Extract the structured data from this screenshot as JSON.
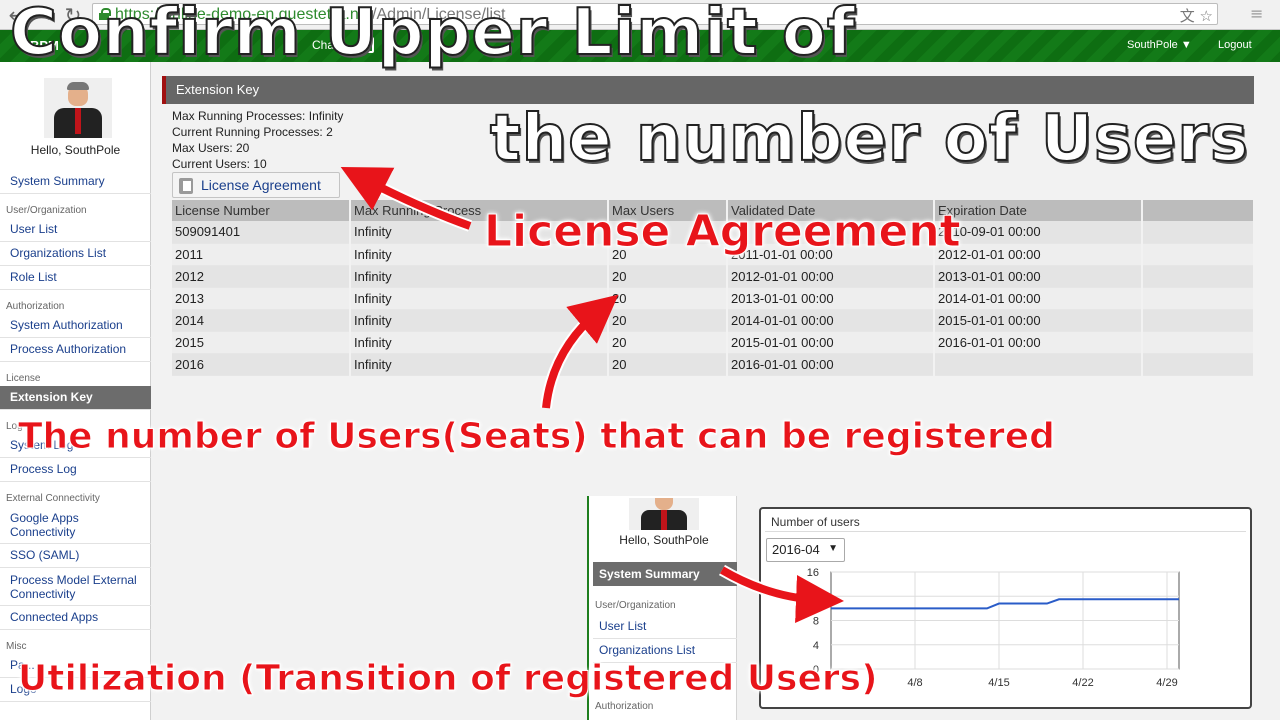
{
  "browser": {
    "back_icon": "back-arrow-icon",
    "forward_icon": "forward-arrow-icon",
    "reload_icon": "reload-icon",
    "url_scheme": "https://",
    "url_host": "online-demo-en.questetra.net",
    "url_path": "/Admin/License/list",
    "icons": [
      "translate-icon",
      "star-icon",
      "menu-icon"
    ]
  },
  "header": {
    "logo": "BPM",
    "chat": "Chat",
    "user_menu": "SouthPole ▼",
    "logout": "Logout"
  },
  "sidebar": {
    "greeting": "Hello, SouthPole",
    "items": [
      {
        "type": "item",
        "label": "System Summary"
      },
      {
        "type": "section",
        "label": "User/Organization"
      },
      {
        "type": "item",
        "label": "User List"
      },
      {
        "type": "item",
        "label": "Organizations List"
      },
      {
        "type": "item",
        "label": "Role List"
      },
      {
        "type": "section",
        "label": "Authorization"
      },
      {
        "type": "item",
        "label": "System Authorization"
      },
      {
        "type": "item",
        "label": "Process Authorization"
      },
      {
        "type": "section",
        "label": "License"
      },
      {
        "type": "item",
        "label": "Extension Key",
        "active": true
      },
      {
        "type": "section",
        "label": "Log"
      },
      {
        "type": "item",
        "label": "System Log"
      },
      {
        "type": "item",
        "label": "Process Log"
      },
      {
        "type": "section",
        "label": "External Connectivity"
      },
      {
        "type": "item",
        "label": "Google Apps Connectivity",
        "tall": true
      },
      {
        "type": "item",
        "label": "SSO (SAML)"
      },
      {
        "type": "item",
        "label": "Process Model External Connectivity",
        "tall": true
      },
      {
        "type": "item",
        "label": "Connected Apps"
      },
      {
        "type": "section",
        "label": "Misc"
      },
      {
        "type": "item",
        "label": "Pa..."
      },
      {
        "type": "item",
        "label": "Logo"
      }
    ]
  },
  "main": {
    "section_title": "Extension Key",
    "info": [
      "Max Running Processes: Infinity",
      "Current Running Processes: 2",
      "Max Users: 20",
      "Current Users: 10"
    ],
    "license_button": "License Agreement",
    "table": {
      "columns": [
        "License Number",
        "Max Running Process",
        "Max Users",
        "Validated Date",
        "Expiration Date",
        ""
      ],
      "rows": [
        [
          "509091401",
          "Infinity",
          "",
          "",
          "2010-09-01 00:00",
          ""
        ],
        [
          "2011",
          "Infinity",
          "20",
          "2011-01-01 00:00",
          "2012-01-01 00:00",
          ""
        ],
        [
          "2012",
          "Infinity",
          "20",
          "2012-01-01 00:00",
          "2013-01-01 00:00",
          ""
        ],
        [
          "2013",
          "Infinity",
          "20",
          "2013-01-01 00:00",
          "2014-01-01 00:00",
          ""
        ],
        [
          "2014",
          "Infinity",
          "20",
          "2014-01-01 00:00",
          "2015-01-01 00:00",
          ""
        ],
        [
          "2015",
          "Infinity",
          "20",
          "2015-01-01 00:00",
          "2016-01-01 00:00",
          ""
        ],
        [
          "2016",
          "Infinity",
          "20",
          "2016-01-01 00:00",
          "",
          ""
        ]
      ]
    }
  },
  "mini_screen": {
    "greeting": "Hello, SouthPole",
    "summary": "System Summary",
    "section_user": "User/Organization",
    "item_users": "User List",
    "item_orgs": "Organizations List",
    "section_auth": "Authorization"
  },
  "chart_panel": {
    "title": "Number of users",
    "month": "2016-04"
  },
  "chart_data": {
    "type": "line",
    "title": "Number of users",
    "xlabel": "",
    "ylabel": "",
    "x_ticks": [
      "4/8",
      "4/15",
      "4/22",
      "4/29"
    ],
    "y_ticks": [
      0,
      4,
      8,
      12,
      16
    ],
    "ylim": [
      0,
      16
    ],
    "grid": true,
    "series": [
      {
        "color": "#2a5cc8",
        "x": [
          "4/1",
          "4/2",
          "4/3",
          "4/4",
          "4/5",
          "4/6",
          "4/7",
          "4/8",
          "4/9",
          "4/10",
          "4/11",
          "4/12",
          "4/13",
          "4/14",
          "4/15",
          "4/16",
          "4/17",
          "4/18",
          "4/19",
          "4/20",
          "4/21",
          "4/22",
          "4/23",
          "4/24",
          "4/25",
          "4/26",
          "4/27",
          "4/28",
          "4/29",
          "4/30"
        ],
        "values": [
          10,
          10,
          10,
          10,
          10,
          10,
          10,
          10,
          10,
          10,
          10,
          10,
          10,
          10,
          10.8,
          10.8,
          10.8,
          10.8,
          10.8,
          11.5,
          11.5,
          11.5,
          11.5,
          11.5,
          11.5,
          11.5,
          11.5,
          11.5,
          11.5,
          11.5
        ]
      }
    ]
  },
  "overlays": {
    "title_line1": "Confirm Upper Limit of",
    "title_line2": "the number of Users",
    "annotation_license": "License Agreement",
    "annotation_seats": "The number of Users(Seats) that can be registered",
    "annotation_utilization": "Utilization (Transition of registered Users)",
    "arrow_color": "#e8141a"
  }
}
